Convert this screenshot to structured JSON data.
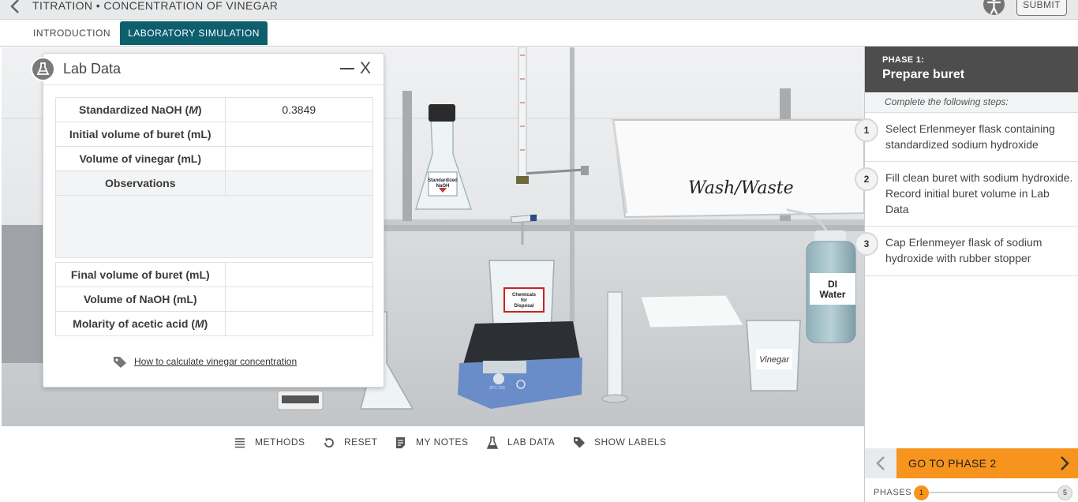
{
  "header": {
    "title": "TITRATION • CONCENTRATION OF VINEGAR",
    "submit_label": "SUBMIT",
    "back_icon": "chevron-left-icon",
    "accessibility_icon": "accessibility-icon"
  },
  "tabs": [
    {
      "label": "INTRODUCTION",
      "active": false
    },
    {
      "label": "LABORATORY SIMULATION",
      "active": true
    }
  ],
  "lab_data": {
    "title": "Lab Data",
    "minimize_label": "—",
    "close_label": "X",
    "rows": [
      {
        "label_pre": "Standardized NaOH (",
        "label_em": "M",
        "label_post": ")",
        "value": "0.3849"
      },
      {
        "label_pre": "Initial volume of buret (mL)",
        "label_em": "",
        "label_post": "",
        "value": ""
      },
      {
        "label_pre": "Volume of vinegar (mL)",
        "label_em": "",
        "label_post": "",
        "value": ""
      }
    ],
    "observations_label": "Observations",
    "observations_value": "",
    "rows_after": [
      {
        "label_pre": "Final volume of buret (mL)",
        "label_em": "",
        "label_post": "",
        "value": ""
      },
      {
        "label_pre": "Volume of NaOH (mL)",
        "label_em": "",
        "label_post": "",
        "value": ""
      },
      {
        "label_pre": "Molarity of acetic acid (",
        "label_em": "M",
        "label_post": ")",
        "value": ""
      }
    ],
    "help_link": "How to calculate vinegar concentration"
  },
  "scene": {
    "wash_label": "Wash/Waste",
    "di_water_label_1": "DI",
    "di_water_label_2": "Water",
    "vinegar_label": "Vinegar",
    "flask_label_1": "Standardized",
    "flask_label_2": "NaOH",
    "beaker_label_1": "Chemicals",
    "beaker_label_2": "for",
    "beaker_label_3": "Disposal",
    "stirrer_label": "ATC-100"
  },
  "toolbar": [
    {
      "label": "METHODS",
      "icon": "list-icon"
    },
    {
      "label": "RESET",
      "icon": "reset-icon"
    },
    {
      "label": "MY NOTES",
      "icon": "notes-icon"
    },
    {
      "label": "LAB DATA",
      "icon": "flask-icon"
    },
    {
      "label": "SHOW LABELS",
      "icon": "tag-icon"
    }
  ],
  "phase": {
    "number_label": "PHASE 1:",
    "title": "Prepare buret",
    "subtitle": "Complete the following steps:",
    "steps": [
      {
        "num": "1",
        "text": "Select Erlenmeyer flask containing standardized sodium hydroxide"
      },
      {
        "num": "2",
        "text": "Fill clean buret with sodium hydroxide. Record initial buret volume in Lab Data"
      },
      {
        "num": "3",
        "text": "Cap Erlenmeyer flask of sodium hydroxide with rubber stopper"
      }
    ],
    "next_label": "GO TO PHASE 2",
    "phases_label": "PHASES",
    "current_phase": "1",
    "total_phases": "5"
  },
  "colors": {
    "tab_active": "#0d5f6e",
    "next_button": "#f7941d",
    "phase_header": "#4d4d4d"
  }
}
